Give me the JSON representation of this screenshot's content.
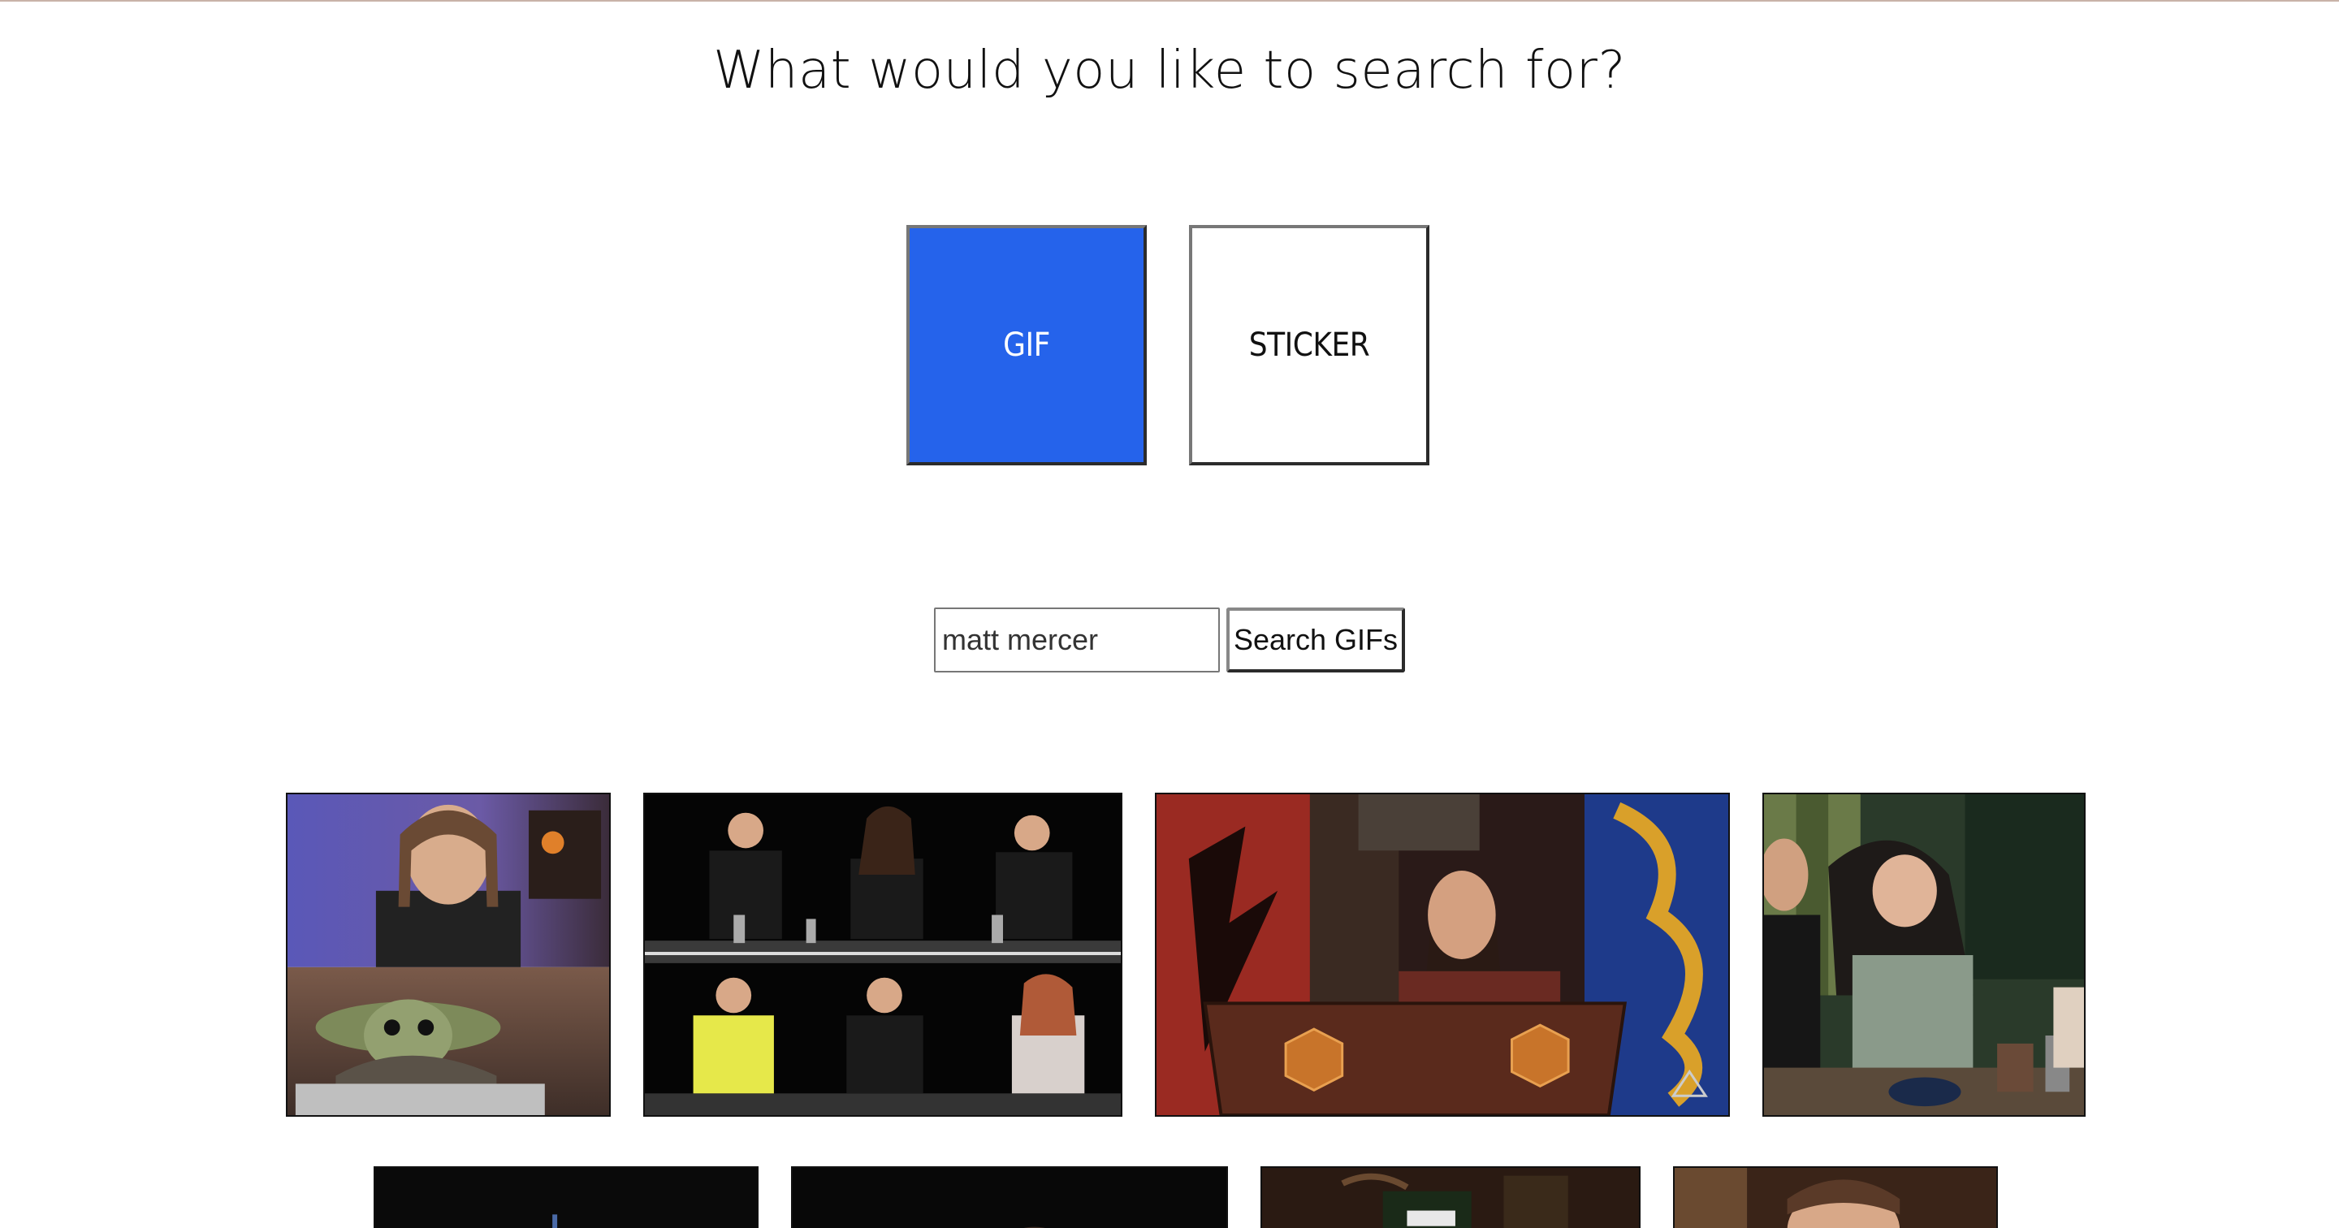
{
  "heading": "What would you like to search for?",
  "type_options": {
    "gif_label": "GIF",
    "sticker_label": "STICKER",
    "selected": "GIF"
  },
  "search": {
    "value": "matt mercer",
    "button_label": "Search GIFs"
  },
  "colors": {
    "selected_type": "#2563eb",
    "text": "#111111",
    "background": "#ffffff"
  },
  "results": [
    {
      "icon": "gif-thumbnail-man-and-baby-yoda"
    },
    {
      "icon": "gif-thumbnail-panel-at-table"
    },
    {
      "icon": "gif-thumbnail-dungeon-master-screen"
    },
    {
      "icon": "gif-thumbnail-woman-laughing"
    },
    {
      "icon": "gif-thumbnail-dark"
    },
    {
      "icon": "gif-thumbnail-dark"
    },
    {
      "icon": "gif-thumbnail-costume-scene"
    },
    {
      "icon": "gif-thumbnail-man-closeup"
    }
  ]
}
